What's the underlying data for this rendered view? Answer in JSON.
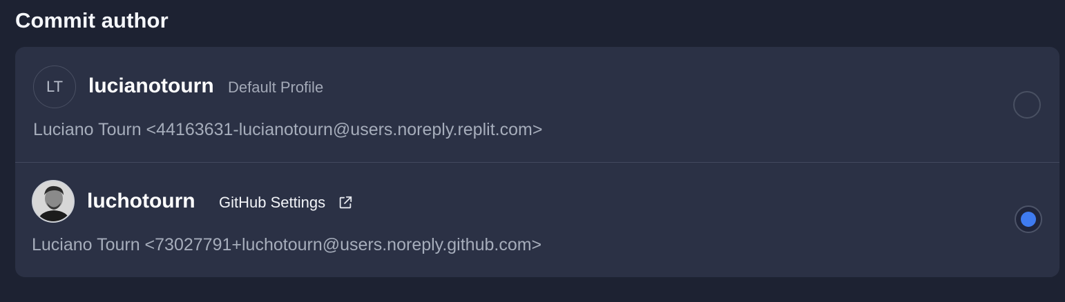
{
  "section": {
    "title": "Commit author"
  },
  "authors": [
    {
      "initials": "LT",
      "username": "lucianotourn",
      "tag": "Default Profile",
      "email": "Luciano Tourn <44163631-lucianotourn@users.noreply.replit.com>",
      "selected": false
    },
    {
      "username": "luchotourn",
      "link_label": "GitHub Settings",
      "link_icon": "external-link-icon",
      "email": "Luciano Tourn <73027791+luchotourn@users.noreply.github.com>",
      "selected": true
    }
  ],
  "colors": {
    "background": "#1d2232",
    "card": "#2b3145",
    "accent": "#3f7bf0"
  }
}
